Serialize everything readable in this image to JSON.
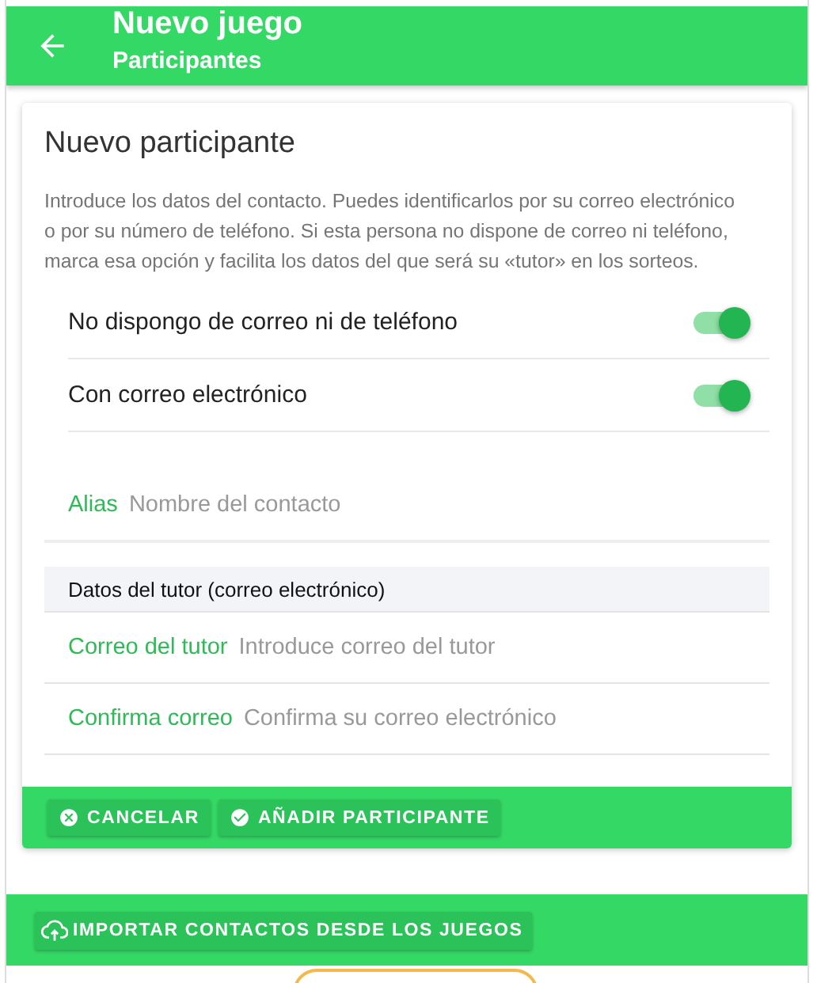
{
  "app_bar": {
    "title": "Nuevo juego",
    "subtitle": "Participantes"
  },
  "card": {
    "title": "Nuevo participante",
    "description": "Introduce los datos del contacto. Puedes identificarlos por su correo electrónico o por su número de teléfono. Si esta persona no dispone de correo ni teléfono, marca esa opción y facilita los datos del que será su «tutor» en los sorteos.",
    "toggles": [
      {
        "label": "No dispongo de correo ni de teléfono",
        "on": true
      },
      {
        "label": "Con correo electrónico",
        "on": true
      }
    ],
    "alias_field": {
      "label": "Alias",
      "placeholder": "Nombre del contacto"
    },
    "tutor_section": {
      "title": "Datos del tutor (correo electrónico)",
      "fields": [
        {
          "label": "Correo del tutor",
          "placeholder": "Introduce correo del tutor"
        },
        {
          "label": "Confirma correo",
          "placeholder": "Confirma su correo electrónico"
        }
      ]
    },
    "actions": [
      {
        "label": "CANCELAR",
        "kind": "cancel"
      },
      {
        "label": "AÑADIR PARTICIPANTE",
        "kind": "confirm"
      }
    ]
  },
  "bottom_bar": {
    "buttons": [
      {
        "label": "IMPORTAR CONTACTOS DESDE LOS JUEGOS",
        "kind": "import"
      }
    ]
  }
}
